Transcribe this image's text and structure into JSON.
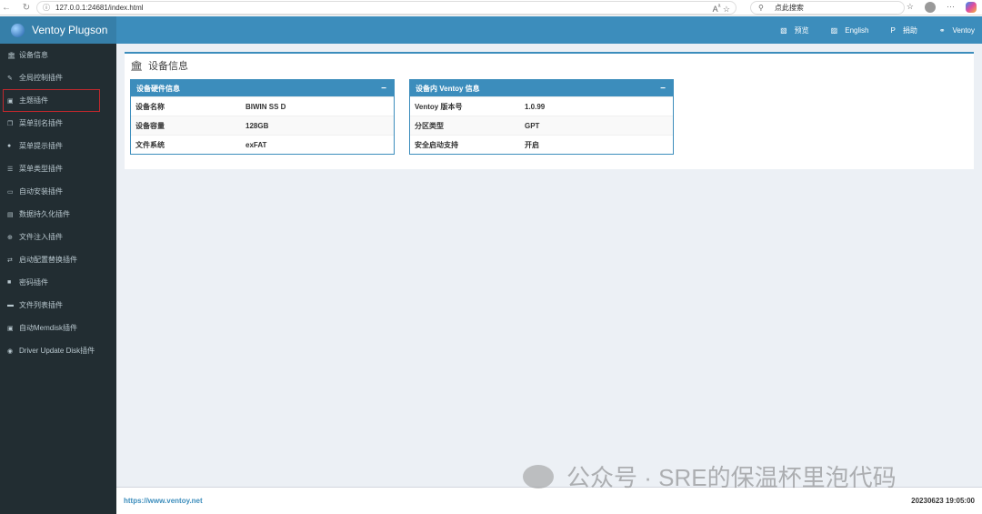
{
  "browser": {
    "url": "127.0.0.1:24681/index.html",
    "search_placeholder": "点此搜索"
  },
  "app": {
    "title": "Ventoy Plugson"
  },
  "topnav": [
    {
      "icon": "preview-icon",
      "label": "预览"
    },
    {
      "icon": "language-icon",
      "label": "English"
    },
    {
      "icon": "paypal-icon",
      "label": "捐助"
    },
    {
      "icon": "link-icon",
      "label": "Ventoy"
    }
  ],
  "sidebar": {
    "items": [
      {
        "label": "设备信息",
        "icon": "bank-icon"
      },
      {
        "label": "全局控制插件",
        "icon": "wrench-icon"
      },
      {
        "label": "主题插件",
        "icon": "image-file-icon",
        "selected": true
      },
      {
        "label": "菜单别名插件",
        "icon": "copy-icon"
      },
      {
        "label": "菜单提示插件",
        "icon": "comment-icon"
      },
      {
        "label": "菜单类型插件",
        "icon": "list-icon"
      },
      {
        "label": "自动安装插件",
        "icon": "desktop-icon"
      },
      {
        "label": "数据持久化插件",
        "icon": "database-icon"
      },
      {
        "label": "文件注入插件",
        "icon": "plus-circle-icon"
      },
      {
        "label": "启动配置替换插件",
        "icon": "retweet-icon"
      },
      {
        "label": "密码插件",
        "icon": "lock-icon"
      },
      {
        "label": "文件列表插件",
        "icon": "window-icon"
      },
      {
        "label": "自动Memdisk插件",
        "icon": "save-icon"
      },
      {
        "label": "Driver Update Disk插件",
        "icon": "globe-icon"
      }
    ]
  },
  "main": {
    "title": "设备信息",
    "panels": [
      {
        "title": "设备硬件信息",
        "rows": [
          [
            "设备名称",
            "BIWIN SS D"
          ],
          [
            "设备容量",
            "128GB"
          ],
          [
            "文件系统",
            "exFAT"
          ]
        ]
      },
      {
        "title": "设备内 Ventoy 信息",
        "rows": [
          [
            "Ventoy 版本号",
            "1.0.99"
          ],
          [
            "分区类型",
            "GPT"
          ],
          [
            "安全启动支持",
            "开启"
          ]
        ]
      }
    ]
  },
  "footer": {
    "link": "https://www.ventoy.net",
    "datetime": "20230623 19:05:00"
  },
  "watermark": "公众号 · SRE的保温杯里泡代码",
  "colors": {
    "primary": "#3c8dbc",
    "sidebar": "#222d32",
    "selected_outline": "#c0282d"
  }
}
